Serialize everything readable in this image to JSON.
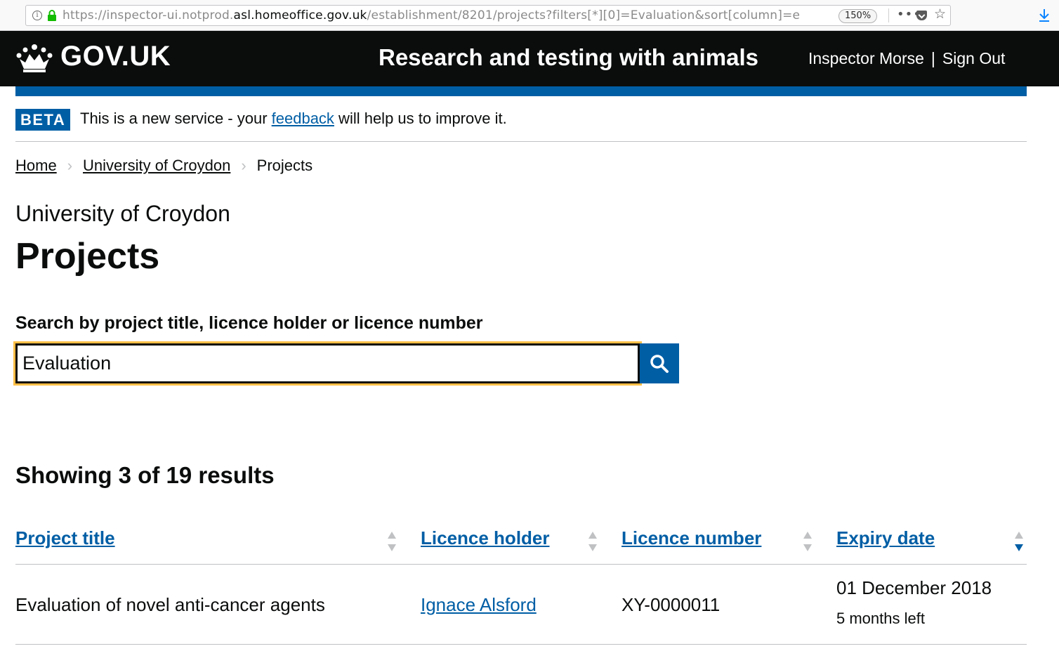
{
  "browser": {
    "url_prefix": "https://inspector-ui.notprod.",
    "url_domain": "asl.homeoffice.gov.uk",
    "url_rest": "/establishment/8201/projects?filters[*][0]=Evaluation&sort[column]=e",
    "zoom": "150%",
    "icons": [
      "info-icon",
      "lock-icon",
      "more-dots-icon",
      "pocket-icon",
      "bookmark-star-icon",
      "download-icon"
    ]
  },
  "header": {
    "logo_text": "GOV.UK",
    "service_name": "Research and testing with animals",
    "user_name": "Inspector Morse",
    "separator": "|",
    "sign_out": "Sign Out",
    "stripe_color": "#005ea5"
  },
  "beta": {
    "tag": "BETA",
    "text_before": "This is a new service - your ",
    "link": "feedback",
    "text_after": " will help us to improve it."
  },
  "breadcrumbs": {
    "items": [
      "Home",
      "University of Croydon",
      "Projects"
    ]
  },
  "page": {
    "caption": "University of Croydon",
    "title": "Projects"
  },
  "search": {
    "label": "Search by project title, licence holder or licence number",
    "value": "Evaluation",
    "button_icon": "search-icon"
  },
  "results": {
    "heading": "Showing 3 of 19 results",
    "columns": [
      "Project title",
      "Licence holder",
      "Licence number",
      "Expiry date"
    ],
    "active_sort_column": "Expiry date",
    "active_sort_direction": "descending",
    "rows": [
      {
        "title": "Evaluation of novel anti-cancer agents",
        "holder": "Ignace Alsford",
        "licence_number": "XY-0000011",
        "expiry_date": "01 December 2018",
        "expiry_remaining": "5 months left"
      }
    ]
  },
  "colors": {
    "link": "#005ea5",
    "text": "#0b0c0c",
    "focus": "#ffbf47",
    "header_bg": "#0b0c0c"
  }
}
